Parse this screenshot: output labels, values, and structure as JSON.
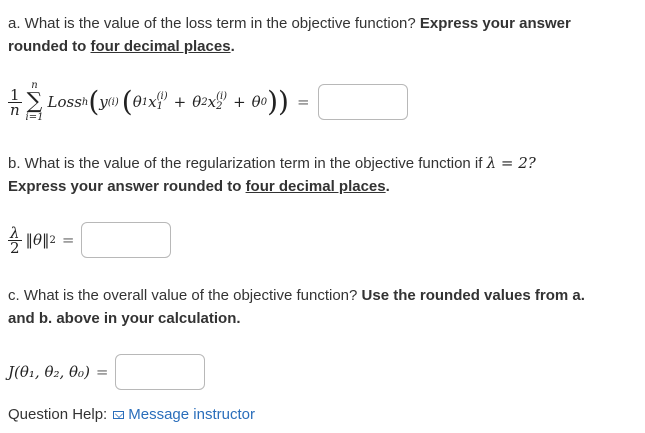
{
  "part_a": {
    "q_start": "a. What is the value of the loss term in the objective function? ",
    "q_bold1": "Express your answer rounded to ",
    "q_under": "four decimal places",
    "q_end": ".",
    "frac_num": "1",
    "frac_den": "n",
    "sum_top": "n",
    "sum_bottom": "i=1",
    "loss_name": "Loss",
    "loss_sub": "h",
    "y_sup": "(i)",
    "theta1": "θ",
    "x1_sup": "(i)",
    "x1_sub": "1",
    "x2_sup": "(i)",
    "x2_sub": "2",
    "theta0": "θ",
    "equals": "=",
    "answer_value": ""
  },
  "part_b": {
    "q_start": "b. What is the value of the regularization term in the objective function if ",
    "lambda_eq": "λ = 2?",
    "q_bold1": "Express your answer rounded to ",
    "q_under": "four decimal places",
    "q_end": ".",
    "frac_num": "λ",
    "frac_den": "2",
    "norm_expr": "‖θ‖",
    "norm_sup": "2",
    "equals": "=",
    "answer_value": ""
  },
  "part_c": {
    "q_start": "c. What is the overall value of the objective function? ",
    "q_bold": "Use the rounded values from a. and b. above in your calculation.",
    "lhs": "J(θ₁, θ₂, θ₀)",
    "equals": "=",
    "answer_value": ""
  },
  "help": {
    "label": "Question Help:",
    "link": "Message instructor"
  }
}
